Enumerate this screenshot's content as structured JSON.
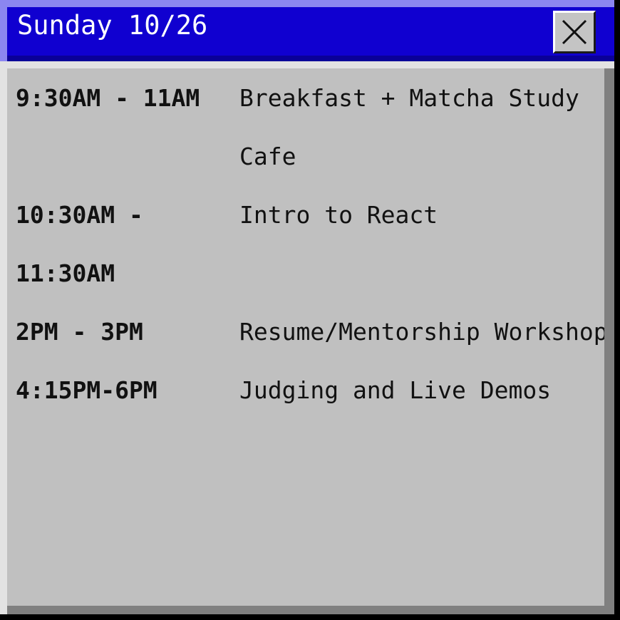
{
  "window": {
    "title": "Sunday 10/26",
    "close_icon": "close-icon"
  },
  "schedule": [
    {
      "time_line1": "9:30AM - 11AM",
      "time_line2": "",
      "event_line1": "Breakfast + Matcha Study",
      "event_line2": "Cafe"
    },
    {
      "time_line1": "10:30AM -",
      "time_line2": "11:30AM",
      "event_line1": "Intro to React",
      "event_line2": ""
    },
    {
      "time_line1": "2PM - 3PM",
      "time_line2": "",
      "event_line1": "Resume/Mentorship Workshop",
      "event_line2": ""
    },
    {
      "time_line1": "4:15PM-6PM",
      "time_line2": "",
      "event_line1": "Judging and Live Demos",
      "event_line2": ""
    }
  ],
  "colors": {
    "titlebar": "#1000d0",
    "content": "#c0c0c0",
    "text": "#111111"
  }
}
